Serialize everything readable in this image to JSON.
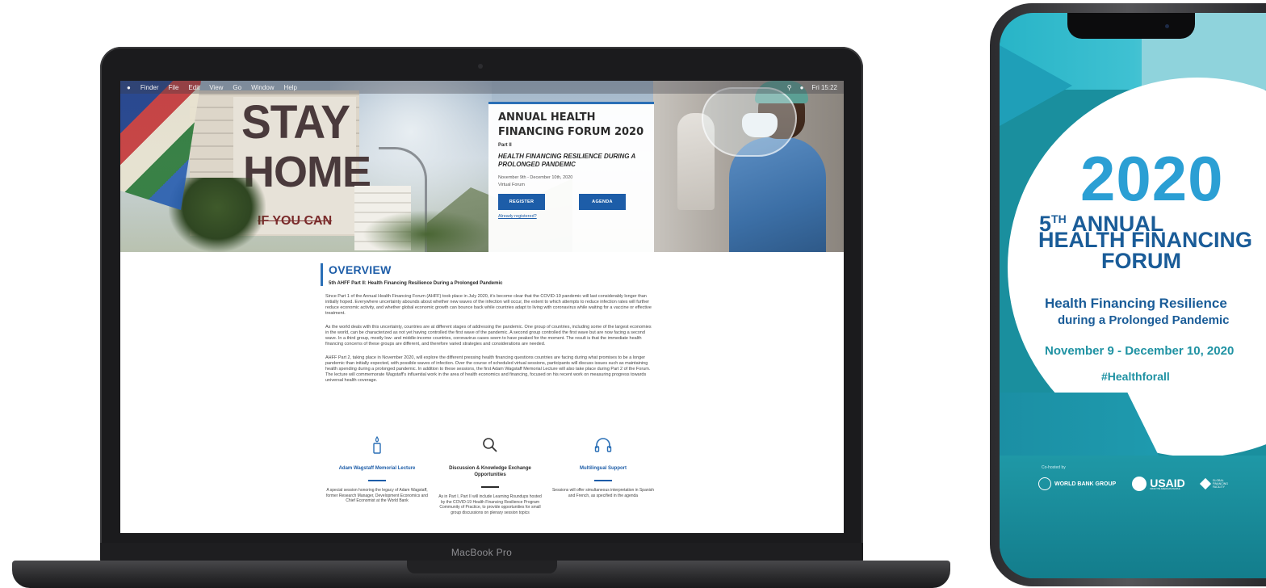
{
  "device": {
    "laptop_label": "MacBook Pro"
  },
  "menubar": {
    "apple_icon": "apple-icon",
    "items": [
      "Finder",
      "File",
      "Edit",
      "View",
      "Go",
      "Window",
      "Help"
    ],
    "clock": "Fri 15:22"
  },
  "hero": {
    "sign_line1": "STAY",
    "sign_line2": "HOME",
    "sign_line3": "IF YOU CAN",
    "title": "ANNUAL HEALTH FINANCING FORUM 2020",
    "part": "Part II",
    "subtitle": "HEALTH FINANCING RESILIENCE DURING A PROLONGED PANDEMIC",
    "dates": "November 9th - December 10th, 2020",
    "venue": "Virtual Forum",
    "register_label": "REGISTER",
    "agenda_label": "AGENDA",
    "already_label": "Already registered?"
  },
  "overview": {
    "title": "OVERVIEW",
    "subtitle": "5th AHFF Part II: Health Financing Resilience During a Prolonged Pandemic",
    "paragraphs": [
      "Since Part 1 of the Annual Health Financing Forum (AHFF) took place in July 2020, it's become clear that the COVID-19 pandemic will last considerably longer than initially hoped. Everywhere uncertainty abounds about whether new waves of the infection will occur, the extent to which attempts to reduce infection rates will further reduce economic activity, and whether global economic growth can bounce back while countries adapt to living with coronavirus while waiting for a vaccine or effective treatment.",
      "As the world deals with this uncertainty, countries are at different stages of addressing the pandemic. One group of countries, including some of the largest economies in the world, can be characterized as not yet having controlled the first wave of the pandemic. A second group controlled the first wave but are now facing a second wave. In a third group, mostly low- and middle-income countries, coronavirus cases seem to have peaked for the moment. The result is that the immediate health financing concerns of these groups are different, and therefore varied strategies and considerations are needed.",
      "AHFF Part 2, taking place in November 2020, will explore the different pressing health financing questions countries are facing during what promises to be a longer pandemic than initially expected, with possible waves of infection. Over the course of scheduled virtual sessions, participants will discuss issues such as maintaining health spending during a prolonged pandemic. In addition to these sessions, the first Adam Wagstaff Memorial Lecture will also take place during Part 2 of the Forum. The lecture will commemorate Wagstaff's influential work in the area of health economics and financing, focused on his recent work on measuring progress towards universal health coverage."
    ]
  },
  "features": [
    {
      "icon": "candle-icon",
      "title": "Adam Wagstaff Memorial Lecture",
      "desc": "A special session honoring the legacy of Adam Wagstaff, former Research Manager, Development Economics and Chief Economist at the World Bank",
      "accent": "#1d5da8"
    },
    {
      "icon": "search-icon",
      "title": "Discussion & Knowledge Exchange Opportunities",
      "desc": "As in Part I, Part II will include Learning Roundups hosted by the COVID-19 Health Financing Resilience Program Community of Practice, to provide opportunities for small group discussions on plenary session topics",
      "accent": "#2b2b2b"
    },
    {
      "icon": "headphones-icon",
      "title": "Multilingual Support",
      "desc": "Sessions will offer simultaneous interpretation in Spanish and French, as specified in the agenda",
      "accent": "#1d5da8"
    }
  ],
  "phone": {
    "year": "2020",
    "ordinal": "5",
    "ordinal_suffix": "TH",
    "annual": "ANNUAL",
    "line2": "HEALTH FINANCING",
    "line3": "FORUM",
    "tagline1": "Health Financing Resilience",
    "tagline2": "during a Prolonged Pandemic",
    "dates": "November 9 - December 10, 2020",
    "hashtag": "#Healthforall",
    "cohost": "Co-hosted by",
    "logos": {
      "wbg": "WORLD BANK GROUP",
      "usaid": "USAID",
      "usaid_sub": "FROM THE AMERICAN PEOPLE",
      "gff": "GLOBAL FINANCING FACILITY"
    }
  },
  "colors": {
    "brand_blue": "#1d5da8",
    "accent_blue": "#2a6fb6",
    "phone_teal": "#1a8f9e",
    "phone_title": "#1a5c98"
  }
}
